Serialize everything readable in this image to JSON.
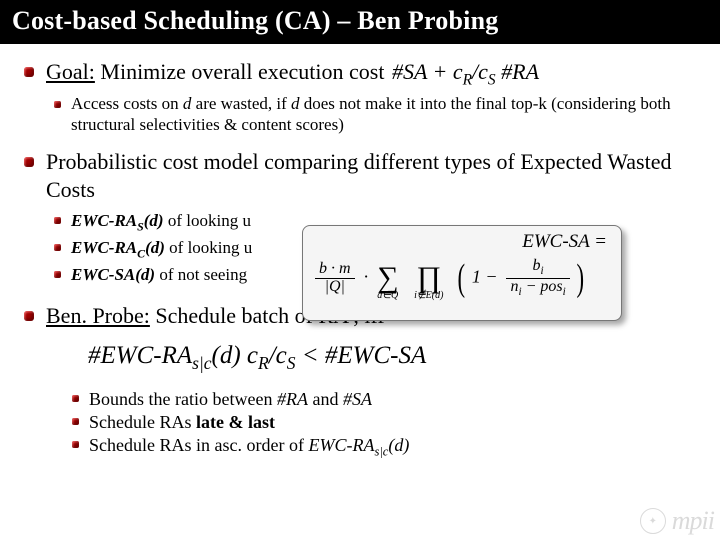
{
  "title": "Cost-based Scheduling (CA) – Ben Probing",
  "b1": {
    "prefix": "Goal:",
    "text": " Minimize overall execution cost ",
    "formula": "#SA + c",
    "formula_sub1": "R",
    "formula_mid": "/c",
    "formula_sub2": "S",
    "formula_tail": " #RA"
  },
  "b1_sub": {
    "l1": "Access costs on ",
    "d": "d",
    "l2": " are wasted, if ",
    "l3": " does not make it into the final top-k (considering both structural selectivities & content scores)"
  },
  "b2": "Probabilistic cost model comparing different types of Expected Wasted Costs",
  "ewc": {
    "a1_head": "EWC-RA",
    "a1_sub": "S",
    "a1_tail": "(d)",
    "a1_rest": " of looking u",
    "a2_head": "EWC-RA",
    "a2_sub": "C",
    "a2_tail": "(d)",
    "a2_rest": " of looking u",
    "a3_head": "EWC-SA(d)",
    "a3_rest": " of not seeing"
  },
  "float": {
    "lhs": "EWC-SA =",
    "bm": "b · m",
    "Q": "|Q|",
    "sigma_top": "",
    "sigma_bot": "d∈Q",
    "prod_top": "",
    "prod_bot": "i∉E(d)",
    "one": "1 −",
    "bi": "b",
    "bi_sub": "i",
    "den": "n",
    "den_sub": "i",
    "den2": " − pos",
    "den2_sub": "i"
  },
  "b3_a": "Ben. Probe:",
  "b3_b": " Schedule batch of RA               , iff",
  "ineq": {
    "p1": "#EWC-RA",
    "p1_sub": "s|c",
    "p2": "(d)  c",
    "p2_sub": "R",
    "p3": "/c",
    "p3_sub": "S",
    "p4": " <  #EWC-SA"
  },
  "bl": {
    "l1a": "Bounds the ratio between ",
    "l1b": "#RA",
    "l1c": " and  ",
    "l1d": "#SA",
    "l2a": "Schedule RAs ",
    "l2b": "late & last",
    "l3a": "Schedule RAs in asc. order of ",
    "l3b": "EWC-RA",
    "l3b_sub": "s|c",
    "l3c": "(d)"
  },
  "logo": "mpii"
}
